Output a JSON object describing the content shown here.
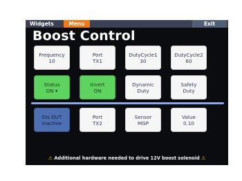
{
  "topbar": {
    "widgets": "Widgets",
    "menu": "Menu",
    "exit": "Exit"
  },
  "title": "Boost Control",
  "row1": [
    {
      "label": "Frequency",
      "value": "10"
    },
    {
      "label": "Port",
      "value": "TX1"
    },
    {
      "label": "DutyCycle1",
      "value": "30"
    },
    {
      "label": "DutyCycle2",
      "value": "60"
    }
  ],
  "row2": [
    {
      "label": "Status",
      "value": "ON"
    },
    {
      "label": "Invert",
      "value": "ON"
    },
    {
      "label": "Dynamic",
      "value": "Duty"
    },
    {
      "label": "Safety",
      "value": "Duty"
    }
  ],
  "row3": [
    {
      "label": "Dis OUT",
      "value": "inactive"
    },
    {
      "label": "Port",
      "value": "TX2"
    },
    {
      "label": "Sensor",
      "value": "MGP"
    },
    {
      "label": "Value",
      "value": "0.10"
    }
  ],
  "footer": {
    "warning": "Additional hardware needed to drive 12V boost solenoid",
    "icon": "⚠"
  },
  "colors": {
    "accent": "#f07a1a",
    "active": "#5fd35f",
    "disabled": "#4e70b2"
  }
}
